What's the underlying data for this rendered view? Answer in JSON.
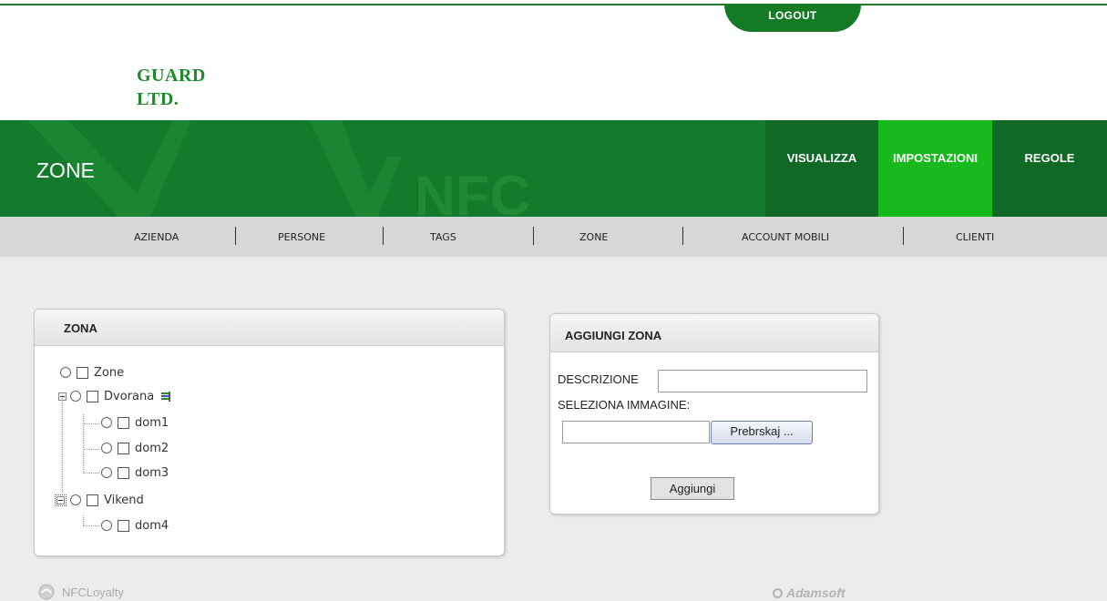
{
  "top": {
    "logout_label": "LOGOUT"
  },
  "brand": {
    "line1": "GUARD",
    "line2": "LTD."
  },
  "header": {
    "title": "ZONE",
    "watermark": "NFC",
    "nav": [
      {
        "label": "VISUALIZZA",
        "active": false
      },
      {
        "label": "IMPOSTAZIONI",
        "active": true
      },
      {
        "label": "REGOLE",
        "active": false
      }
    ],
    "colors": {
      "bar": "#147a2c",
      "active": "#17b91c",
      "nav_dark": "#106a26"
    }
  },
  "subnav": {
    "items": [
      "AZIENDA",
      "PERSONE",
      "TAGS",
      "ZONE",
      "ACCOUNT MOBILI",
      "CLIENTI"
    ]
  },
  "zona_panel": {
    "title": "ZONA",
    "tree": [
      {
        "label": "Zone"
      },
      {
        "label": "Dvorana"
      },
      {
        "label": "dom1"
      },
      {
        "label": "dom2"
      },
      {
        "label": "dom3"
      },
      {
        "label": "Vikend"
      },
      {
        "label": "dom4"
      }
    ]
  },
  "add_panel": {
    "title": "AGGIUNGI ZONA",
    "description_label": "DESCRIZIONE",
    "description_value": "",
    "image_label": "SELEZIONA IMMAGINE:",
    "file_value": "",
    "browse_label": "Prebrskaj ...",
    "submit_label": "Aggiungi"
  },
  "footer": {
    "left_logo": "NFCLoyalty",
    "right_logo": "Adamsoft"
  }
}
